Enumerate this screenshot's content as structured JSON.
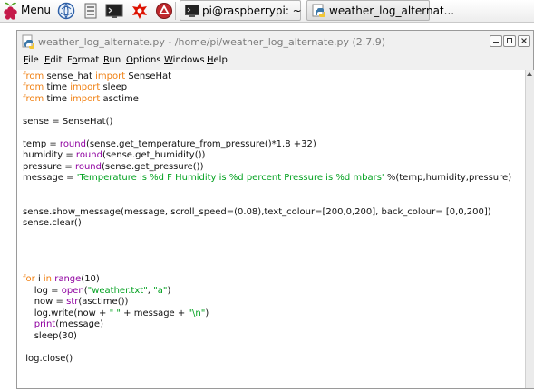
{
  "taskbar": {
    "menu_label": "Menu",
    "launchers": [
      "web-browser-icon",
      "file-manager-icon",
      "terminal-icon",
      "wolfram-icon",
      "mathematica-icon"
    ],
    "tasks": [
      {
        "label": "pi@raspberrypi: ~",
        "icon": "terminal-icon",
        "active": false
      },
      {
        "label": "weather_log_alternat...",
        "icon": "python-idle-icon",
        "active": true
      }
    ]
  },
  "window": {
    "title": "weather_log_alternate.py - /home/pi/weather_log_alternate.py (2.7.9)",
    "controls": [
      "minimize",
      "maximize",
      "close"
    ]
  },
  "menu": [
    {
      "id": "file",
      "label": "File"
    },
    {
      "id": "edit",
      "label": "Edit"
    },
    {
      "id": "format",
      "label": "Format"
    },
    {
      "id": "run",
      "label": "Run"
    },
    {
      "id": "options",
      "label": "Options"
    },
    {
      "id": "windows",
      "label": "Windows"
    },
    {
      "id": "help",
      "label": "Help"
    }
  ],
  "editor": {
    "lines": [
      "from sense_hat import SenseHat",
      "from time import sleep",
      "from time import asctime",
      "",
      "sense = SenseHat()",
      "",
      "temp = round(sense.get_temperature_from_pressure()*1.8 +32)",
      "humidity = round(sense.get_humidity())",
      "pressure = round(sense.get_pressure())",
      "message = 'Temperature is %d F Humidity is %d percent Pressure is %d mbars' %(temp,humidity,pressure)",
      "",
      "",
      "sense.show_message(message, scroll_speed=(0.08),text_colour=[200,0,200], back_colour= [0,0,200])",
      "sense.clear()",
      "",
      "",
      "",
      "",
      "for i in range(10)",
      "    log = open(\"weather.txt\", \"a\")",
      "    now = str(asctime())",
      "    log.write(now + \" \" + message + \"\\n\")",
      "    print(message)",
      "    sleep(30)",
      "",
      " log.close()"
    ]
  },
  "colors": {
    "keyword": "#f07f10",
    "builtin": "#8f00a0",
    "string": "#00a01e",
    "default": "#111111"
  }
}
